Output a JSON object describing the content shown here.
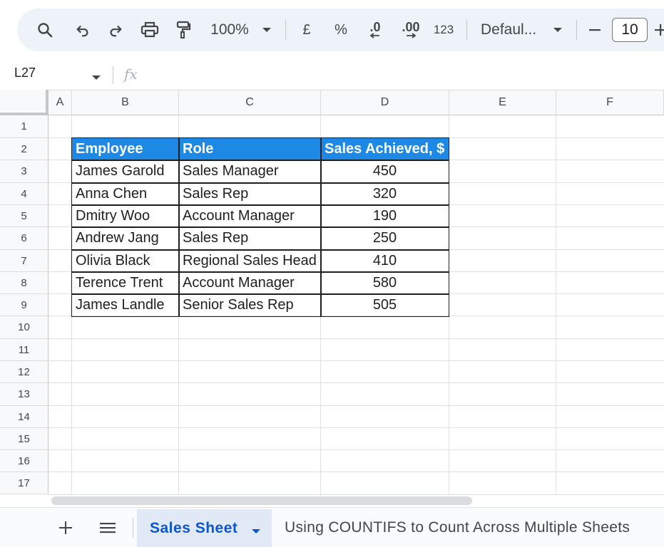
{
  "toolbar": {
    "zoom": "100%",
    "currency": "£",
    "percent": "%",
    "dec_decrease": ".0",
    "dec_increase": ".00",
    "number_format": "123",
    "font": "Defaul...",
    "font_size": "10"
  },
  "formula_bar": {
    "cell_ref": "L27",
    "fx": "fx"
  },
  "columns": [
    "A",
    "B",
    "C",
    "D",
    "E",
    "F"
  ],
  "rows": [
    "1",
    "2",
    "3",
    "4",
    "5",
    "6",
    "7",
    "8",
    "9",
    "10",
    "11",
    "12",
    "13",
    "14",
    "15",
    "16",
    "17"
  ],
  "table": {
    "headers": [
      "Employee",
      "Role",
      "Sales Achieved, $"
    ],
    "rows": [
      [
        "James Garold",
        "Sales Manager",
        "450"
      ],
      [
        "Anna Chen",
        "Sales Rep",
        "320"
      ],
      [
        "Dmitry Woo",
        "Account Manager",
        "190"
      ],
      [
        "Andrew Jang",
        "Sales Rep",
        "250"
      ],
      [
        "Olivia Black",
        "Regional Sales Head",
        "410"
      ],
      [
        "Terence Trent",
        "Account Manager",
        "580"
      ],
      [
        "James Landle",
        "Senior Sales Rep",
        "505"
      ]
    ]
  },
  "sheet_tabs": {
    "active": "Sales Sheet",
    "other": "Using COUNTIFS to Count Across Multiple Sheets"
  },
  "colors": {
    "header_fill": "#1e88e5",
    "active_tab_text": "#0b57d0",
    "toolbar_bg": "#eef2f9"
  }
}
